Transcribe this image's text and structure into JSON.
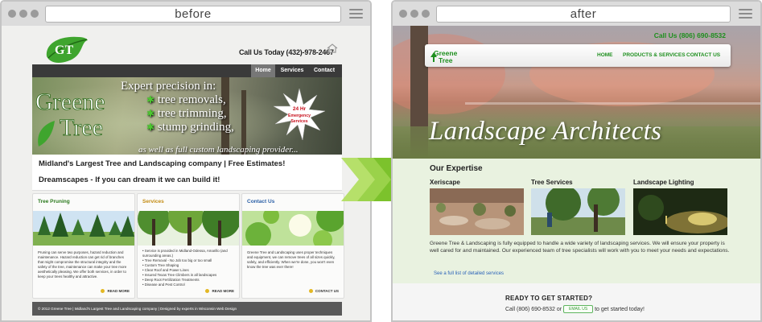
{
  "before": {
    "url_label": "before",
    "site": {
      "logo_text": "GT",
      "phone": "Call Us Today (432)-978-2467",
      "nav": [
        "Home",
        "Services",
        "Contact"
      ],
      "banner": {
        "brand_line1": "Greene",
        "brand_line2": "Tree",
        "expert": "Expert precision in:",
        "bullets": [
          "tree removals,",
          "tree trimming,",
          "stump grinding,"
        ],
        "as_well": "as well as full custom landscaping provider...",
        "burst_line1": "24 Hr",
        "burst_line2": "Emergency",
        "burst_line3": "Services"
      },
      "tagline1": "Midland's Largest Tree and Landscaping company | Free Estimates!",
      "tagline2": "Dreamscapes - If you can dream it we can build it!",
      "columns": [
        {
          "title": "Tree Pruning",
          "title_color": "#2c7a1e",
          "text": "Pruning can serve two purposes, hazard reduction and maintenance. Hazard reduction can get rid of branches that might compromise the structural integrity and the safety of the tree, maintenance can make your tree more aesthetically pleasing. We offer both services, in order to keep your trees healthy and attractive.",
          "more": "READ MORE"
        },
        {
          "title": "Services",
          "title_color": "#c38b12",
          "items": [
            "Service is provided in Midland-Odessa, Amarillo (and surrounding areas.)",
            "Tree Removal - No Job too big or too small",
            "Custom Tree Shaping",
            "Clear Roof and Power Lines",
            "Insured Texas Tree Climbers in all landscapes",
            "Deep Root Fertilization Treatments",
            "Disease and Pest Control"
          ],
          "more": "READ MORE"
        },
        {
          "title": "Contact Us",
          "title_color": "#2a5fa6",
          "text": "Greene Tree and Landscaping uses proper techniques and equipment, we can remove trees of all sizes quickly, safely, and efficiently. When we're done, you won't even know the tree was ever there!",
          "more": "CONTACT US"
        }
      ],
      "footer": "© 2012 Greene Tree | Midland's Largest Tree and Landscaping company | Designed by experts in Wisconsin Web Design"
    }
  },
  "after": {
    "url_label": "after",
    "site": {
      "phone": "Call Us (806) 690-8532",
      "logo_line1": "Greene",
      "logo_line2": "Tree",
      "nav": [
        "HOME",
        "PRODUCTS & SERVICES",
        "CONTACT US"
      ],
      "headline": "Landscape Architects",
      "section_title": "Our Expertise",
      "cards": [
        "Xeriscape",
        "Tree Services",
        "Landscape Lighting"
      ],
      "paragraph": "Greene Tree & Landscaping is fully equipped to handle a wide variety of landscaping services. We will ensure your property is well cared for and maintained. Our experienced team of tree specialists will work with you to meet your needs and expectations.",
      "link": "See a full list of detailed services",
      "cta_title": "READY TO GET STARTED?",
      "cta_prefix": "Call (806) 690-8532 or",
      "cta_button": "EMAIL US",
      "cta_suffix": "to get started today!"
    }
  },
  "colors": {
    "brand_green": "#1e8f1e",
    "arrow_green": "#8ccc3a",
    "chrome_gray": "#dcdcdc"
  }
}
